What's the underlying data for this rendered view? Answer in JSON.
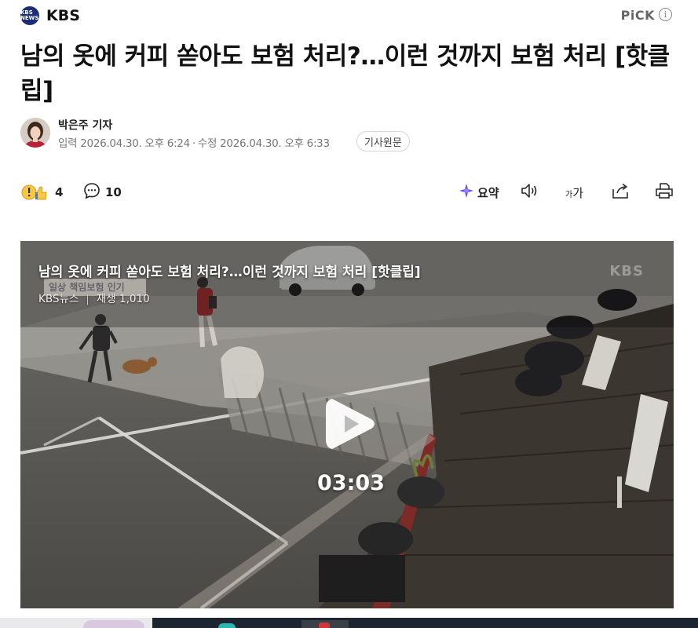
{
  "header": {
    "logo_text": "KBS NEWS",
    "press_name": "KBS",
    "pick_label": "PiCK",
    "info_symbol": "i"
  },
  "article": {
    "title": "남의 옷에 커피 쏟아도 보험 처리?…이런 것까지 보험 처리 [핫클립]",
    "reporter": "박은주 기자",
    "published_label": "입력",
    "published": "2026.04.30. 오후 6:24",
    "modified_label": "수정",
    "modified": "2026.04.30. 오후 6:33",
    "original_button": "기사원문"
  },
  "toolbar": {
    "reaction_count": "4",
    "comment_count": "10",
    "summary_label": "요약",
    "fontsize_small": "가",
    "fontsize_large": "가",
    "icons": [
      "reaction-emoji-icon",
      "comment-icon",
      "ai-summary-icon",
      "speaker-icon",
      "font-size-icon",
      "share-icon",
      "print-icon"
    ]
  },
  "video": {
    "title": "남의 옷에 커피 쏟아도 보험 처리?…이런 것까지 보험 처리 [핫클립]",
    "channel": "KBS뉴스",
    "views": "재생 1,010",
    "duration": "03:03",
    "watermark": "KBS",
    "caption_overlay": "일상 책임보험 인기"
  },
  "colors": {
    "kbs_blue": "#1a2e7a",
    "text": "#111111",
    "muted": "#777777",
    "summary_purple": "#6a4df5"
  }
}
